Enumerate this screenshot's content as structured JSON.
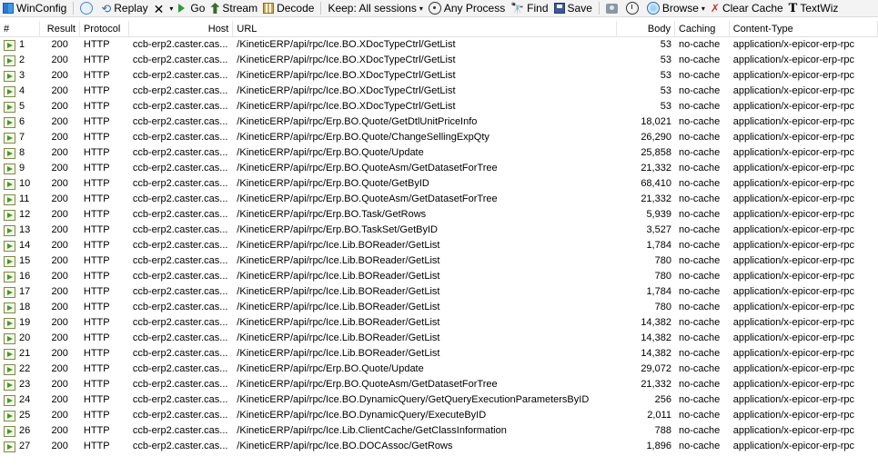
{
  "toolbar": {
    "winconfig": "WinConfig",
    "replay": "Replay",
    "go": "Go",
    "stream": "Stream",
    "decode": "Decode",
    "keep": "Keep: All sessions",
    "any_process": "Any Process",
    "find": "Find",
    "save": "Save",
    "browse": "Browse",
    "clear_cache": "Clear Cache",
    "textwiz": "TextWiz"
  },
  "columns": {
    "num": "#",
    "result": "Result",
    "protocol": "Protocol",
    "host": "Host",
    "url": "URL",
    "body": "Body",
    "caching": "Caching",
    "content_type": "Content-Type"
  },
  "sessions": [
    {
      "num": "1",
      "result": "200",
      "protocol": "HTTP",
      "host": "ccb-erp2.caster.cas...",
      "url": "/KineticERP/api/rpc/Ice.BO.XDocTypeCtrl/GetList",
      "body": "53",
      "caching": "no-cache",
      "content_type": "application/x-epicor-erp-rpc"
    },
    {
      "num": "2",
      "result": "200",
      "protocol": "HTTP",
      "host": "ccb-erp2.caster.cas...",
      "url": "/KineticERP/api/rpc/Ice.BO.XDocTypeCtrl/GetList",
      "body": "53",
      "caching": "no-cache",
      "content_type": "application/x-epicor-erp-rpc"
    },
    {
      "num": "3",
      "result": "200",
      "protocol": "HTTP",
      "host": "ccb-erp2.caster.cas...",
      "url": "/KineticERP/api/rpc/Ice.BO.XDocTypeCtrl/GetList",
      "body": "53",
      "caching": "no-cache",
      "content_type": "application/x-epicor-erp-rpc"
    },
    {
      "num": "4",
      "result": "200",
      "protocol": "HTTP",
      "host": "ccb-erp2.caster.cas...",
      "url": "/KineticERP/api/rpc/Ice.BO.XDocTypeCtrl/GetList",
      "body": "53",
      "caching": "no-cache",
      "content_type": "application/x-epicor-erp-rpc"
    },
    {
      "num": "5",
      "result": "200",
      "protocol": "HTTP",
      "host": "ccb-erp2.caster.cas...",
      "url": "/KineticERP/api/rpc/Ice.BO.XDocTypeCtrl/GetList",
      "body": "53",
      "caching": "no-cache",
      "content_type": "application/x-epicor-erp-rpc"
    },
    {
      "num": "6",
      "result": "200",
      "protocol": "HTTP",
      "host": "ccb-erp2.caster.cas...",
      "url": "/KineticERP/api/rpc/Erp.BO.Quote/GetDtlUnitPriceInfo",
      "body": "18,021",
      "caching": "no-cache",
      "content_type": "application/x-epicor-erp-rpc"
    },
    {
      "num": "7",
      "result": "200",
      "protocol": "HTTP",
      "host": "ccb-erp2.caster.cas...",
      "url": "/KineticERP/api/rpc/Erp.BO.Quote/ChangeSellingExpQty",
      "body": "26,290",
      "caching": "no-cache",
      "content_type": "application/x-epicor-erp-rpc"
    },
    {
      "num": "8",
      "result": "200",
      "protocol": "HTTP",
      "host": "ccb-erp2.caster.cas...",
      "url": "/KineticERP/api/rpc/Erp.BO.Quote/Update",
      "body": "25,858",
      "caching": "no-cache",
      "content_type": "application/x-epicor-erp-rpc"
    },
    {
      "num": "9",
      "result": "200",
      "protocol": "HTTP",
      "host": "ccb-erp2.caster.cas...",
      "url": "/KineticERP/api/rpc/Erp.BO.QuoteAsm/GetDatasetForTree",
      "body": "21,332",
      "caching": "no-cache",
      "content_type": "application/x-epicor-erp-rpc"
    },
    {
      "num": "10",
      "result": "200",
      "protocol": "HTTP",
      "host": "ccb-erp2.caster.cas...",
      "url": "/KineticERP/api/rpc/Erp.BO.Quote/GetByID",
      "body": "68,410",
      "caching": "no-cache",
      "content_type": "application/x-epicor-erp-rpc"
    },
    {
      "num": "11",
      "result": "200",
      "protocol": "HTTP",
      "host": "ccb-erp2.caster.cas...",
      "url": "/KineticERP/api/rpc/Erp.BO.QuoteAsm/GetDatasetForTree",
      "body": "21,332",
      "caching": "no-cache",
      "content_type": "application/x-epicor-erp-rpc"
    },
    {
      "num": "12",
      "result": "200",
      "protocol": "HTTP",
      "host": "ccb-erp2.caster.cas...",
      "url": "/KineticERP/api/rpc/Erp.BO.Task/GetRows",
      "body": "5,939",
      "caching": "no-cache",
      "content_type": "application/x-epicor-erp-rpc"
    },
    {
      "num": "13",
      "result": "200",
      "protocol": "HTTP",
      "host": "ccb-erp2.caster.cas...",
      "url": "/KineticERP/api/rpc/Erp.BO.TaskSet/GetByID",
      "body": "3,527",
      "caching": "no-cache",
      "content_type": "application/x-epicor-erp-rpc"
    },
    {
      "num": "14",
      "result": "200",
      "protocol": "HTTP",
      "host": "ccb-erp2.caster.cas...",
      "url": "/KineticERP/api/rpc/Ice.Lib.BOReader/GetList",
      "body": "1,784",
      "caching": "no-cache",
      "content_type": "application/x-epicor-erp-rpc"
    },
    {
      "num": "15",
      "result": "200",
      "protocol": "HTTP",
      "host": "ccb-erp2.caster.cas...",
      "url": "/KineticERP/api/rpc/Ice.Lib.BOReader/GetList",
      "body": "780",
      "caching": "no-cache",
      "content_type": "application/x-epicor-erp-rpc"
    },
    {
      "num": "16",
      "result": "200",
      "protocol": "HTTP",
      "host": "ccb-erp2.caster.cas...",
      "url": "/KineticERP/api/rpc/Ice.Lib.BOReader/GetList",
      "body": "780",
      "caching": "no-cache",
      "content_type": "application/x-epicor-erp-rpc"
    },
    {
      "num": "17",
      "result": "200",
      "protocol": "HTTP",
      "host": "ccb-erp2.caster.cas...",
      "url": "/KineticERP/api/rpc/Ice.Lib.BOReader/GetList",
      "body": "1,784",
      "caching": "no-cache",
      "content_type": "application/x-epicor-erp-rpc"
    },
    {
      "num": "18",
      "result": "200",
      "protocol": "HTTP",
      "host": "ccb-erp2.caster.cas...",
      "url": "/KineticERP/api/rpc/Ice.Lib.BOReader/GetList",
      "body": "780",
      "caching": "no-cache",
      "content_type": "application/x-epicor-erp-rpc"
    },
    {
      "num": "19",
      "result": "200",
      "protocol": "HTTP",
      "host": "ccb-erp2.caster.cas...",
      "url": "/KineticERP/api/rpc/Ice.Lib.BOReader/GetList",
      "body": "14,382",
      "caching": "no-cache",
      "content_type": "application/x-epicor-erp-rpc"
    },
    {
      "num": "20",
      "result": "200",
      "protocol": "HTTP",
      "host": "ccb-erp2.caster.cas...",
      "url": "/KineticERP/api/rpc/Ice.Lib.BOReader/GetList",
      "body": "14,382",
      "caching": "no-cache",
      "content_type": "application/x-epicor-erp-rpc"
    },
    {
      "num": "21",
      "result": "200",
      "protocol": "HTTP",
      "host": "ccb-erp2.caster.cas...",
      "url": "/KineticERP/api/rpc/Ice.Lib.BOReader/GetList",
      "body": "14,382",
      "caching": "no-cache",
      "content_type": "application/x-epicor-erp-rpc"
    },
    {
      "num": "22",
      "result": "200",
      "protocol": "HTTP",
      "host": "ccb-erp2.caster.cas...",
      "url": "/KineticERP/api/rpc/Erp.BO.Quote/Update",
      "body": "29,072",
      "caching": "no-cache",
      "content_type": "application/x-epicor-erp-rpc"
    },
    {
      "num": "23",
      "result": "200",
      "protocol": "HTTP",
      "host": "ccb-erp2.caster.cas...",
      "url": "/KineticERP/api/rpc/Erp.BO.QuoteAsm/GetDatasetForTree",
      "body": "21,332",
      "caching": "no-cache",
      "content_type": "application/x-epicor-erp-rpc"
    },
    {
      "num": "24",
      "result": "200",
      "protocol": "HTTP",
      "host": "ccb-erp2.caster.cas...",
      "url": "/KineticERP/api/rpc/Ice.BO.DynamicQuery/GetQueryExecutionParametersByID",
      "body": "256",
      "caching": "no-cache",
      "content_type": "application/x-epicor-erp-rpc"
    },
    {
      "num": "25",
      "result": "200",
      "protocol": "HTTP",
      "host": "ccb-erp2.caster.cas...",
      "url": "/KineticERP/api/rpc/Ice.BO.DynamicQuery/ExecuteByID",
      "body": "2,011",
      "caching": "no-cache",
      "content_type": "application/x-epicor-erp-rpc"
    },
    {
      "num": "26",
      "result": "200",
      "protocol": "HTTP",
      "host": "ccb-erp2.caster.cas...",
      "url": "/KineticERP/api/rpc/Ice.Lib.ClientCache/GetClassInformation",
      "body": "788",
      "caching": "no-cache",
      "content_type": "application/x-epicor-erp-rpc"
    },
    {
      "num": "27",
      "result": "200",
      "protocol": "HTTP",
      "host": "ccb-erp2.caster.cas...",
      "url": "/KineticERP/api/rpc/Ice.BO.DOCAssoc/GetRows",
      "body": "1,896",
      "caching": "no-cache",
      "content_type": "application/x-epicor-erp-rpc"
    }
  ]
}
